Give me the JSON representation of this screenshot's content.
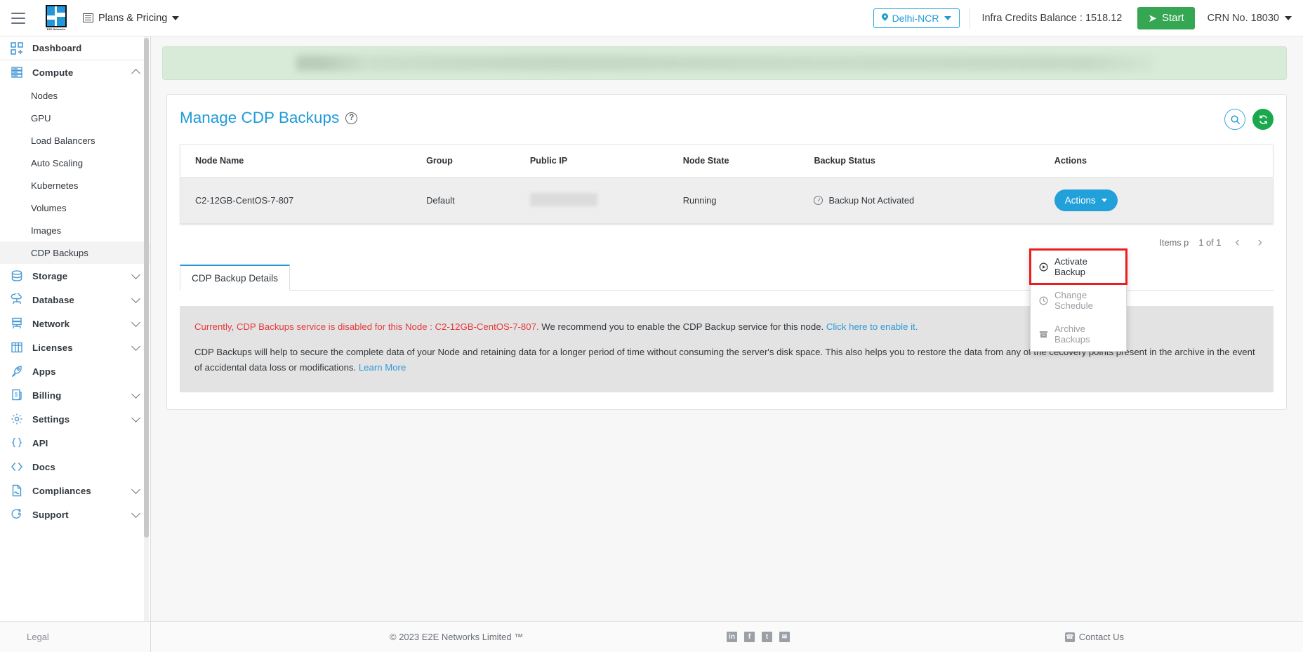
{
  "header": {
    "menu_icon": "hamburger-icon",
    "logo_caption": "E2E Networks",
    "plans_label": "Plans & Pricing",
    "region": "Delhi-NCR",
    "credits_label": "Infra Credits Balance : 1518.12",
    "start_label": "Start",
    "crn_label": "CRN No. 18030"
  },
  "sidebar": {
    "items": [
      {
        "label": "Dashboard",
        "icon": "dashboard-icon",
        "expandable": false
      },
      {
        "label": "Compute",
        "icon": "server-icon",
        "expandable": true,
        "expanded": true
      },
      {
        "label": "Storage",
        "icon": "database-icon",
        "expandable": true
      },
      {
        "label": "Database",
        "icon": "cloud-database-icon",
        "expandable": true
      },
      {
        "label": "Network",
        "icon": "network-icon",
        "expandable": true
      },
      {
        "label": "Licenses",
        "icon": "grid-icon",
        "expandable": true
      },
      {
        "label": "Apps",
        "icon": "rocket-icon",
        "expandable": false
      },
      {
        "label": "Billing",
        "icon": "invoice-icon",
        "expandable": true
      },
      {
        "label": "Settings",
        "icon": "gear-icon",
        "expandable": true
      },
      {
        "label": "API",
        "icon": "braces-icon",
        "expandable": false
      },
      {
        "label": "Docs",
        "icon": "code-icon",
        "expandable": false
      },
      {
        "label": "Compliances",
        "icon": "document-icon",
        "expandable": true
      },
      {
        "label": "Support",
        "icon": "lifebuoy-icon",
        "expandable": true
      }
    ],
    "compute_children": [
      "Nodes",
      "GPU",
      "Load Balancers",
      "Auto Scaling",
      "Kubernetes",
      "Volumes",
      "Images",
      "CDP Backups"
    ],
    "active_child": "CDP Backups",
    "legal_label": "Legal"
  },
  "main": {
    "page_title": "Manage CDP Backups",
    "help_icon": "question-mark-icon",
    "search_icon": "search-icon",
    "refresh_icon": "refresh-icon",
    "table": {
      "columns": [
        "Node Name",
        "Group",
        "Public IP",
        "Node State",
        "Backup Status",
        "Actions"
      ],
      "rows": [
        {
          "node_name": "C2-12GB-CentOS-7-807",
          "group": "Default",
          "public_ip": "",
          "node_state": "Running",
          "backup_status": "Backup Not Activated",
          "action_label": "Actions"
        }
      ]
    },
    "dropdown": {
      "items": [
        {
          "label": "Activate Backup",
          "icon": "play-circle-icon",
          "enabled": true,
          "highlighted": true
        },
        {
          "label": "Change Schedule",
          "icon": "clock-icon",
          "enabled": false,
          "highlighted": false
        },
        {
          "label": "Archive Backups",
          "icon": "archive-icon",
          "enabled": false,
          "highlighted": false
        }
      ]
    },
    "pagination": {
      "items_per_page_label": "Items p",
      "range_label": "1 of 1",
      "prev_icon": "chevron-left-icon",
      "next_icon": "chevron-right-icon"
    },
    "tabs": [
      {
        "label": "CDP Backup Details",
        "active": true
      }
    ],
    "info": {
      "warning_prefix": "Currently, CDP Backups service is disabled for this Node : C2-12GB-CentOS-7-807.",
      "warning_rest": " We recommend you to enable the CDP Backup service for this node. ",
      "warning_link": "Click here to enable it.",
      "body": "CDP Backups will help to secure the complete data of your Node and retaining data for a longer period of time without consuming the server's disk space. This also helps you to restore the data from any of the cecovery points present in the archive in the event of accidental data loss or modifications. ",
      "body_link": "Learn More"
    }
  },
  "footer": {
    "copyright": "© 2023 E2E Networks Limited ™",
    "social": [
      {
        "name": "linkedin-icon",
        "glyph": "in"
      },
      {
        "name": "facebook-icon",
        "glyph": "f"
      },
      {
        "name": "twitter-icon",
        "glyph": "t"
      },
      {
        "name": "rss-icon",
        "glyph": "≋"
      }
    ],
    "contact_label": "Contact Us",
    "contact_icon": "phone-icon"
  },
  "colors": {
    "brand_blue": "#1f9bd8",
    "green": "#35a752",
    "alert_red": "#ee1c1c",
    "warning_red": "#e4393c"
  }
}
